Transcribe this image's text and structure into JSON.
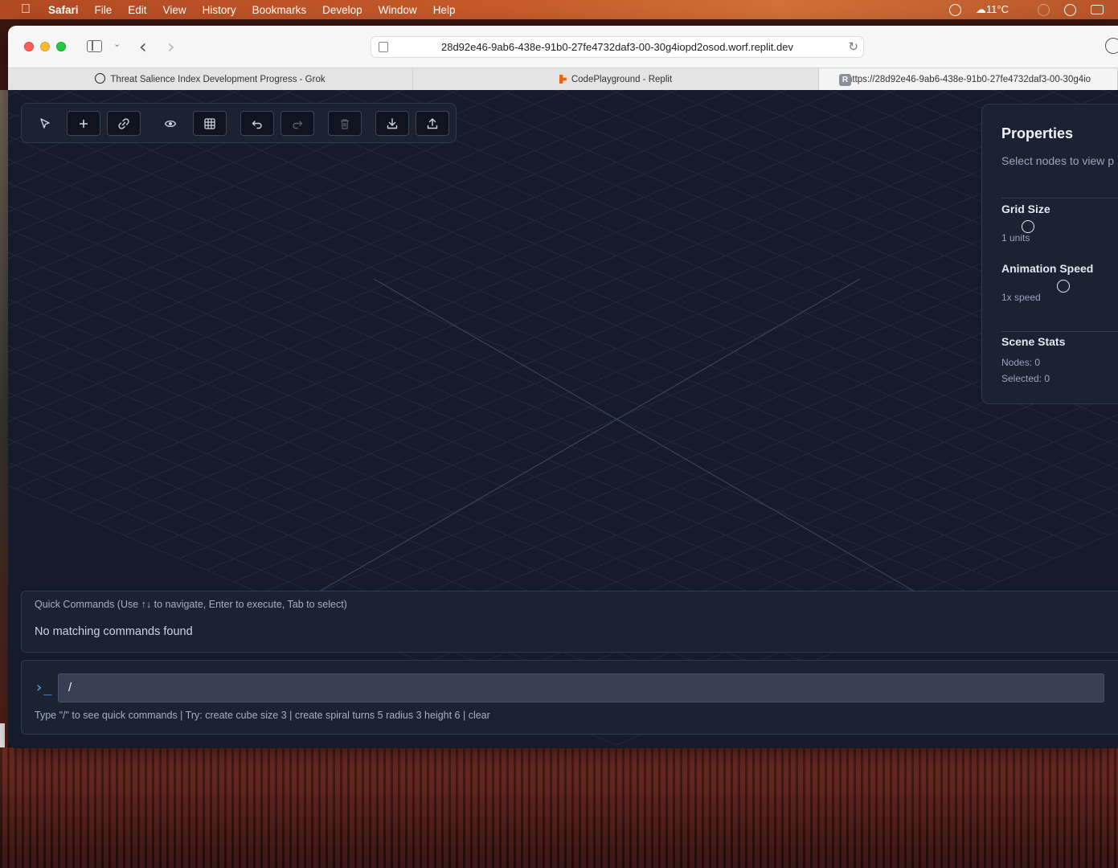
{
  "menubar": {
    "app_name": "Safari",
    "items": [
      "File",
      "Edit",
      "View",
      "History",
      "Bookmarks",
      "Develop",
      "Window",
      "Help"
    ],
    "weather": "11°C"
  },
  "browser": {
    "url": "28d92e46-9ab6-438e-91b0-27fe4732daf3-00-30g4iopd2osod.worf.replit.dev",
    "tabs": [
      {
        "title": "Threat Salience Index Development Progress - Grok",
        "icon": "grok-icon"
      },
      {
        "title": "CodePlayground - Replit",
        "icon": "replit-icon"
      },
      {
        "title": "https://28d92e46-9ab6-438e-91b0-27fe4732daf3-00-30g4io",
        "icon": "r-icon"
      }
    ]
  },
  "toolbar": {
    "tools": [
      "select-icon",
      "add-icon",
      "link-icon",
      "eye-icon",
      "grid-icon",
      "undo-icon",
      "redo-icon",
      "trash-icon",
      "download-icon",
      "upload-icon"
    ]
  },
  "properties": {
    "title": "Properties",
    "subtitle": "Select nodes to view p",
    "grid_size_label": "Grid Size",
    "grid_size_value": "1 units",
    "animation_speed_label": "Animation Speed",
    "animation_speed_value": "1x speed",
    "scene_stats_label": "Scene Stats",
    "nodes": "Nodes: 0",
    "selected": "Selected: 0"
  },
  "quick_commands": {
    "header": "Quick Commands (Use ↑↓ to navigate, Enter to execute, Tab to select)",
    "empty": "No matching commands found"
  },
  "console": {
    "prompt": "›_",
    "input_value": "/",
    "hint": "Type \"/\" to see quick commands | Try: create cube size 3 | create spiral turns 5 radius 3 height 6 | clear"
  },
  "colors": {
    "app_bg": "#151b2b",
    "panel_bg": "#1b2232",
    "accent": "#60a5fa"
  }
}
